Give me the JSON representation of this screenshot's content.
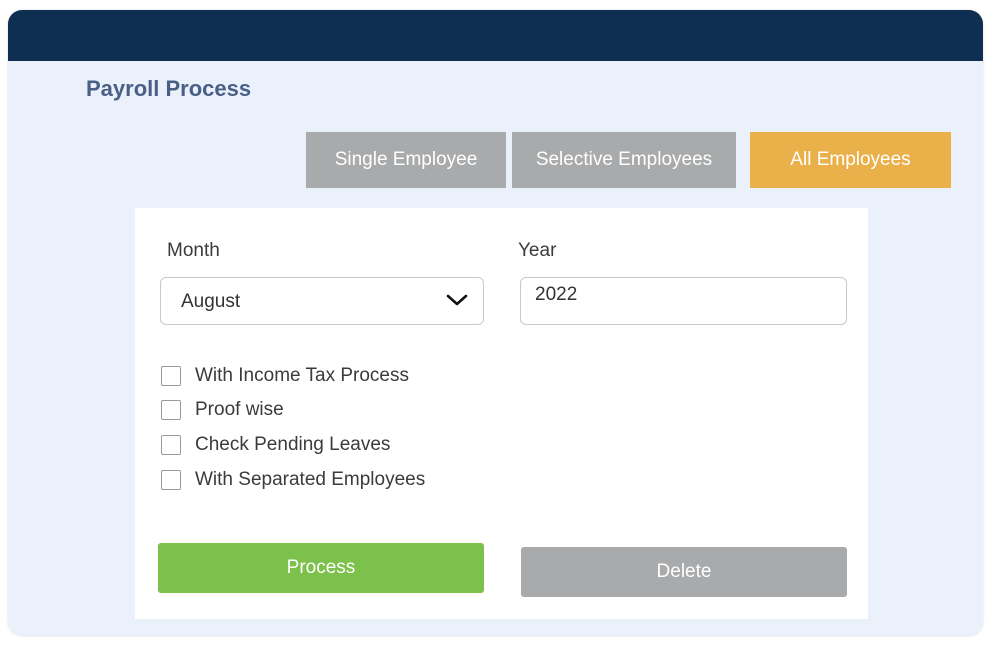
{
  "header": {
    "title": "Payroll Process"
  },
  "tabs": {
    "single": "Single Employee",
    "selective": "Selective Employees",
    "all": "All Employees",
    "active": "All Employees"
  },
  "form": {
    "month_label": "Month",
    "month_value": "August",
    "year_label": "Year",
    "year_value": "2022",
    "checkboxes": [
      {
        "label": "With Income Tax Process",
        "checked": false
      },
      {
        "label": "Proof wise",
        "checked": false
      },
      {
        "label": "Check Pending Leaves",
        "checked": false
      },
      {
        "label": "With Separated Employees",
        "checked": false
      }
    ]
  },
  "actions": {
    "process": "Process",
    "delete": "Delete"
  },
  "colors": {
    "header_bar": "#0f2f52",
    "background": "#eaf1fa",
    "title": "#4a5f86",
    "tab_inactive": "#a9aaab",
    "tab_active": "#eab04a",
    "process_button": "#7cc14c",
    "delete_button": "#a9aaab"
  },
  "icons": {
    "month_dropdown": "chevron-down-icon"
  }
}
